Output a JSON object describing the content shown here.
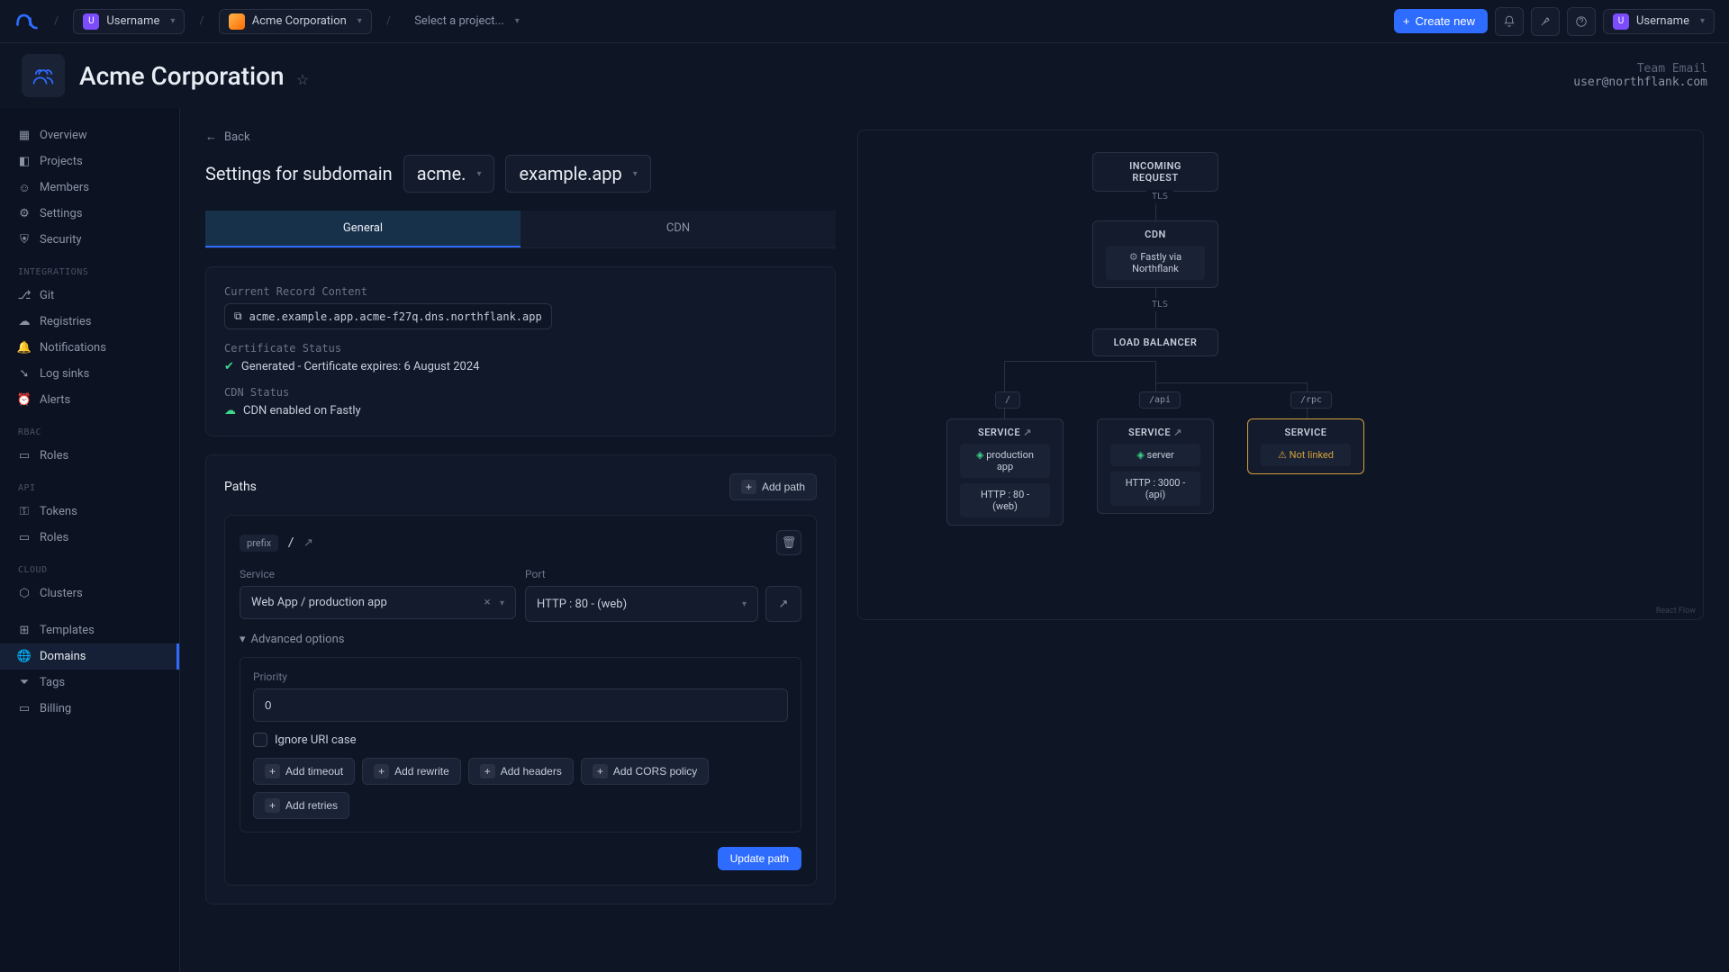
{
  "topbar": {
    "username": "Username",
    "org": "Acme Corporation",
    "project_placeholder": "Select a project...",
    "create_new": "Create new",
    "user_right": "Username"
  },
  "header": {
    "title": "Acme Corporation",
    "team_email_label": "Team Email",
    "team_email": "user@northflank.com"
  },
  "sidebar": {
    "items": {
      "overview": "Overview",
      "projects": "Projects",
      "members": "Members",
      "settings": "Settings",
      "security": "Security"
    },
    "integrations_label": "INTEGRATIONS",
    "integrations": {
      "git": "Git",
      "registries": "Registries",
      "notifications": "Notifications",
      "log_sinks": "Log sinks",
      "alerts": "Alerts"
    },
    "rbac_label": "RBAC",
    "rbac": {
      "roles": "Roles"
    },
    "api_label": "API",
    "api": {
      "tokens": "Tokens",
      "roles": "Roles"
    },
    "cloud_label": "CLOUD",
    "cloud": {
      "clusters": "Clusters"
    },
    "other": {
      "templates": "Templates",
      "domains": "Domains",
      "tags": "Tags",
      "billing": "Billing"
    }
  },
  "page": {
    "back": "Back",
    "title_prefix": "Settings for subdomain",
    "subdomain": "acme.",
    "domain": "example.app",
    "tabs": {
      "general": "General",
      "cdn": "CDN"
    },
    "record_label": "Current Record Content",
    "record_value": "acme.example.app.acme-f27q.dns.northflank.app",
    "cert_label": "Certificate Status",
    "cert_status": "Generated - Certificate expires: 6 August 2024",
    "cdn_label": "CDN Status",
    "cdn_status": "CDN enabled on Fastly",
    "paths_title": "Paths",
    "add_path": "Add path",
    "prefix_tag": "prefix",
    "prefix_value": "/",
    "service_label": "Service",
    "service_value": "Web App / production app",
    "port_label": "Port",
    "port_value": "HTTP : 80 - (web)",
    "advanced": "Advanced options",
    "priority_label": "Priority",
    "priority_value": "0",
    "ignore_uri": "Ignore URI case",
    "pills": {
      "timeout": "Add timeout",
      "rewrite": "Add rewrite",
      "headers": "Add headers",
      "cors": "Add CORS policy",
      "retries": "Add retries"
    },
    "update_path": "Update path"
  },
  "diagram": {
    "incoming": "INCOMING REQUEST",
    "tls": "TLS",
    "cdn": "CDN",
    "cdn_sub": "Fastly via Northflank",
    "lb": "LOAD BALANCER",
    "path_root": "/",
    "path_api": "/api",
    "path_rpc": "/rpc",
    "service": "SERVICE",
    "svc1_name": "production app",
    "svc1_port": "HTTP : 80 - (web)",
    "svc2_name": "server",
    "svc2_port": "HTTP : 3000 - (api)",
    "not_linked": "Not linked",
    "attribution": "React Flow"
  }
}
